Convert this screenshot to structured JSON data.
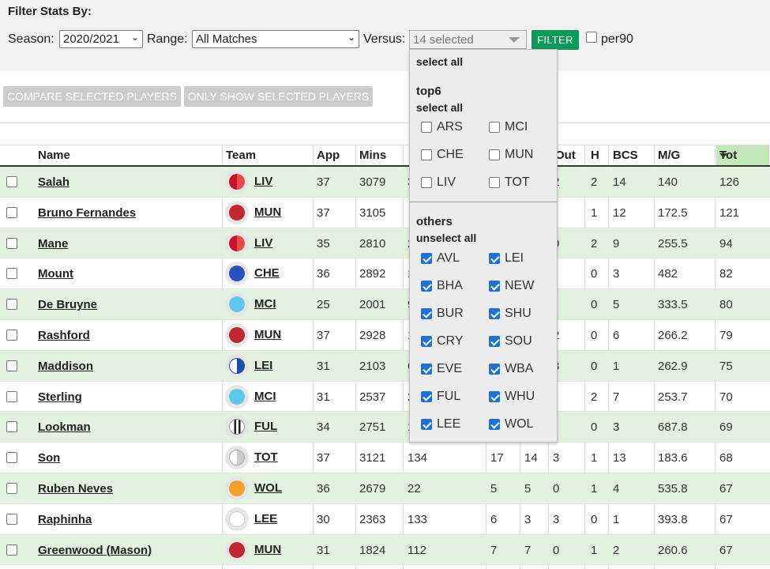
{
  "filter": {
    "title": "Filter Stats By:",
    "season_label": "Season:",
    "season_value": "2020/2021",
    "range_label": "Range:",
    "range_value": "All Matches",
    "versus_label": "Versus:",
    "versus_value": "14 selected",
    "filter_button": "FILTER",
    "per90_label": "per90",
    "per90_checked": false
  },
  "actions": {
    "compare": "COMPARE SELECTED PLAYERS",
    "only_show": "ONLY SHOW SELECTED PLAYERS"
  },
  "table": {
    "headers": {
      "name": "Name",
      "team": "Team",
      "app": "App",
      "mins": "Mins",
      "out": "Out",
      "h": "H",
      "bcs": "BCS",
      "mg": "M/G",
      "tot": "Tot"
    },
    "rows": [
      {
        "name": "Salah",
        "team": "LIV",
        "crest": "liv",
        "app": "37",
        "mins": "3079",
        "c3": "3",
        "c4": "",
        "c5": "",
        "out": "2",
        "h": "2",
        "bcs": "14",
        "mg": "140",
        "tot": "126"
      },
      {
        "name": "Bruno Fernandes",
        "team": "MUN",
        "crest": "mun",
        "app": "37",
        "mins": "3105",
        "c3": "",
        "c4": "",
        "c5": "",
        "out": "",
        "h": "1",
        "bcs": "12",
        "mg": "172.5",
        "tot": "121"
      },
      {
        "name": "Mane",
        "team": "LIV",
        "crest": "liv",
        "app": "35",
        "mins": "2810",
        "c3": "2",
        "c4": "",
        "c5": "",
        "out": "0",
        "h": "2",
        "bcs": "9",
        "mg": "255.5",
        "tot": "94"
      },
      {
        "name": "Mount",
        "team": "CHE",
        "crest": "che",
        "app": "36",
        "mins": "2892",
        "c3": "1",
        "c4": "",
        "c5": "",
        "out": "",
        "h": "0",
        "bcs": "3",
        "mg": "482",
        "tot": "82"
      },
      {
        "name": "De Bruyne",
        "team": "MCI",
        "crest": "mci",
        "app": "25",
        "mins": "2001",
        "c3": "9",
        "c4": "",
        "c5": "",
        "out": "",
        "h": "0",
        "bcs": "5",
        "mg": "333.5",
        "tot": "80"
      },
      {
        "name": "Rashford",
        "team": "MUN",
        "crest": "mun",
        "app": "37",
        "mins": "2928",
        "c3": "1",
        "c4": "",
        "c5": "",
        "out": "2",
        "h": "0",
        "bcs": "6",
        "mg": "266.2",
        "tot": "79"
      },
      {
        "name": "Maddison",
        "team": "LEI",
        "crest": "lei",
        "app": "31",
        "mins": "2103",
        "c3": "6",
        "c4": "",
        "c5": "",
        "out": "3",
        "h": "0",
        "bcs": "1",
        "mg": "262.9",
        "tot": "75"
      },
      {
        "name": "Sterling",
        "team": "MCI",
        "crest": "mci",
        "app": "31",
        "mins": "2537",
        "c3": "2",
        "c4": "",
        "c5": "",
        "out": "",
        "h": "2",
        "bcs": "7",
        "mg": "253.7",
        "tot": "70"
      },
      {
        "name": "Lookman",
        "team": "FUL",
        "crest": "ful",
        "app": "34",
        "mins": "2751",
        "c3": "1",
        "c4": "",
        "c5": "",
        "out": "",
        "h": "0",
        "bcs": "3",
        "mg": "687.8",
        "tot": "69"
      },
      {
        "name": "Son",
        "team": "TOT",
        "crest": "tot",
        "app": "37",
        "mins": "3121",
        "c3": "134",
        "c4": "17",
        "c5": "14",
        "out": "3",
        "h": "1",
        "bcs": "13",
        "mg": "183.6",
        "tot": "68"
      },
      {
        "name": "Ruben Neves",
        "team": "WOL",
        "crest": "wol",
        "app": "36",
        "mins": "2679",
        "c3": "22",
        "c4": "5",
        "c5": "5",
        "out": "0",
        "h": "1",
        "bcs": "4",
        "mg": "535.8",
        "tot": "67"
      },
      {
        "name": "Raphinha",
        "team": "LEE",
        "crest": "lee",
        "app": "30",
        "mins": "2363",
        "c3": "133",
        "c4": "6",
        "c5": "3",
        "out": "3",
        "h": "0",
        "bcs": "1",
        "mg": "393.8",
        "tot": "67"
      },
      {
        "name": "Greenwood (Mason)",
        "team": "MUN",
        "crest": "mun",
        "app": "31",
        "mins": "1824",
        "c3": "112",
        "c4": "7",
        "c5": "7",
        "out": "0",
        "h": "1",
        "bcs": "2",
        "mg": "260.6",
        "tot": "67"
      }
    ]
  },
  "dropdown": {
    "select_all": "select all",
    "top6_label": "top6",
    "top6_select_all": "select all",
    "top6": [
      {
        "code": "ARS",
        "checked": false
      },
      {
        "code": "MCI",
        "checked": false
      },
      {
        "code": "CHE",
        "checked": false
      },
      {
        "code": "MUN",
        "checked": false
      },
      {
        "code": "LIV",
        "checked": false
      },
      {
        "code": "TOT",
        "checked": false
      }
    ],
    "others_label": "others",
    "others_unselect_all": "unselect all",
    "others": [
      {
        "code": "AVL",
        "checked": true
      },
      {
        "code": "LEI",
        "checked": true
      },
      {
        "code": "BHA",
        "checked": true
      },
      {
        "code": "NEW",
        "checked": true
      },
      {
        "code": "BUR",
        "checked": true
      },
      {
        "code": "SHU",
        "checked": true
      },
      {
        "code": "CRY",
        "checked": true
      },
      {
        "code": "SOU",
        "checked": true
      },
      {
        "code": "EVE",
        "checked": true
      },
      {
        "code": "WBA",
        "checked": true
      },
      {
        "code": "FUL",
        "checked": true
      },
      {
        "code": "WHU",
        "checked": true
      },
      {
        "code": "LEE",
        "checked": true
      },
      {
        "code": "WOL",
        "checked": true
      }
    ]
  },
  "colors": {
    "filter_button": "#0a9a5a",
    "row_alt": "#e3f1df",
    "tot_header": "#c4e8b8",
    "checkbox_on": "#1d72d8"
  }
}
